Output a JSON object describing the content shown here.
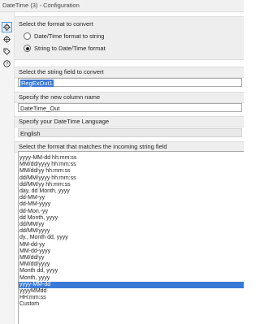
{
  "window": {
    "title": "DateTime (3) - Configuration"
  },
  "sidebar": {
    "icons": [
      "gear-icon",
      "target-icon",
      "tag-icon",
      "help-icon"
    ]
  },
  "format_section": {
    "label": "Select the format to convert",
    "options": [
      "Date/Time format to string",
      "String to Date/Time format"
    ],
    "selected_index": 1
  },
  "string_field": {
    "label": "Select the string field to convert",
    "value": "RegExOut1"
  },
  "new_column": {
    "label": "Specify the new column name",
    "value": "DateTime_Out"
  },
  "language": {
    "label": "Specify your DateTime Language",
    "value": "English"
  },
  "format_list": {
    "label": "Select the format that matches the incoming string field",
    "items": [
      "yyyy-MM-dd hh:mm:ss",
      "MM/dd/yyyy hh:mm:ss",
      "MM/dd/yy hh:mm:ss",
      "dd/MM/yyyy hh:mm:ss",
      "dd/MM/yy hh:mm:ss",
      "day, dd Month, yyyy",
      "dd-MM-yy",
      "dd-MM-yyyy",
      "dd-Mon.-yy",
      "dd Month, yyyy",
      "dd/MM/yy",
      "dd/MM/yyyy",
      "dy., Month dd, yyyy",
      "MM-dd-yy",
      "MM-dd-yyyy",
      "MM/dd/yy",
      "MM/dd/yyyy",
      "Month dd, yyyy",
      "Month, yyyy",
      "yyyy-MM-dd",
      "yyyyMMdd",
      "HH:mm:ss",
      "Custom"
    ],
    "selected_index": 19
  }
}
